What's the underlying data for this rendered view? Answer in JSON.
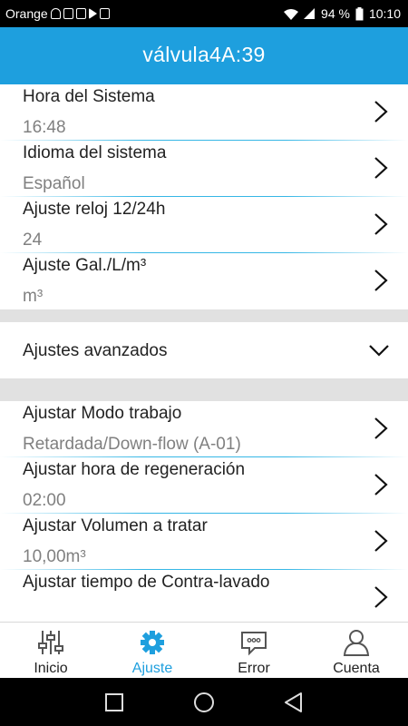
{
  "status_bar": {
    "carrier": "Orange",
    "battery_percent": "94 %",
    "time": "10:10"
  },
  "header": {
    "title": "válvula4A:39",
    "color": "#1e9fde"
  },
  "settings": [
    {
      "label": "Hora del Sistema",
      "value": "16:48"
    },
    {
      "label": "Idioma del sistema",
      "value": "Español"
    },
    {
      "label": "Ajuste reloj 12/24h",
      "value": "24"
    },
    {
      "label": "Ajuste Gal./L/m³",
      "value": "m³"
    }
  ],
  "advanced": {
    "label": "Ajustes avanzados"
  },
  "advanced_settings": [
    {
      "label": "Ajustar Modo trabajo",
      "value": "Retardada/Down-flow (A-01)"
    },
    {
      "label": "Ajustar hora de regeneración",
      "value": "02:00"
    },
    {
      "label": "Ajustar Volumen a tratar",
      "value": "10,00m³"
    },
    {
      "label": "Ajustar tiempo de Contra-lavado",
      "value": ""
    }
  ],
  "bottom_nav": [
    {
      "label": "Inicio",
      "icon": "sliders-icon"
    },
    {
      "label": "Ajuste",
      "icon": "gear-icon",
      "active": true
    },
    {
      "label": "Error",
      "icon": "chat-bubble-icon"
    },
    {
      "label": "Cuenta",
      "icon": "user-icon"
    }
  ]
}
